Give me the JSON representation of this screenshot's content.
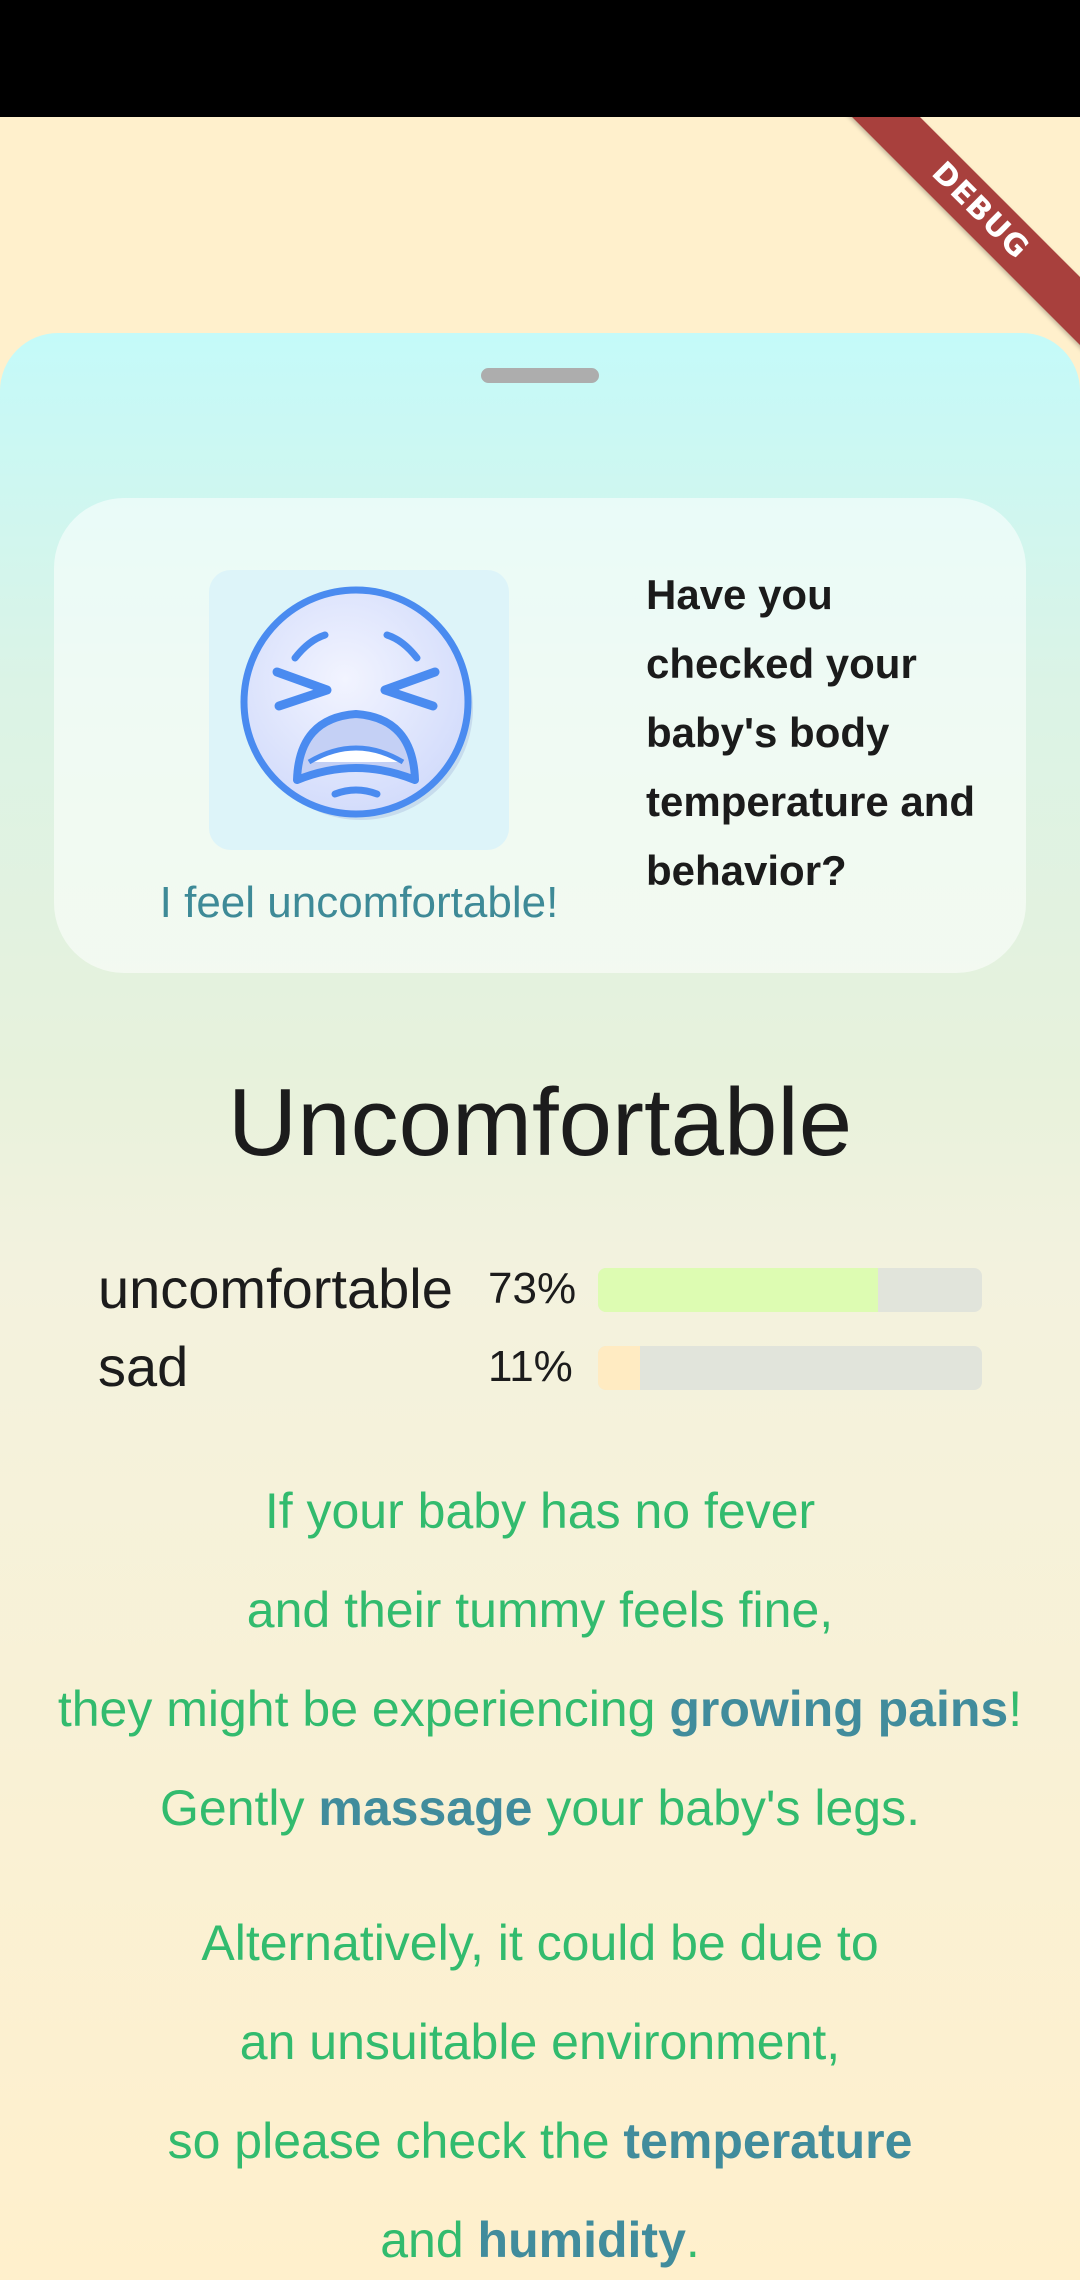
{
  "debug_banner": "DEBUG",
  "card": {
    "emoji": "tired-face-icon",
    "caption": "I feel uncomfortable!",
    "question": "Have you checked your baby's body temperature and behavior?"
  },
  "result_title": "Uncomfortable",
  "probabilities": [
    {
      "label": "uncomfortable",
      "percent_text": "73%",
      "percent": 73,
      "color": "#DDFCB2"
    },
    {
      "label": "sad",
      "percent_text": "11%",
      "percent": 11,
      "color": "#FFEBC2"
    }
  ],
  "advice": {
    "p1": {
      "line1": "If your baby has no fever",
      "line2": "and their tummy feels fine,",
      "line3_pre": "they might be experiencing ",
      "line3_hl": "growing pains",
      "line3_post": "!",
      "line4_pre": "Gently ",
      "line4_hl": "massage",
      "line4_post": " your baby's legs."
    },
    "p2": {
      "line1": "Alternatively, it could be due to",
      "line2": "an unsuitable environment,",
      "line3_pre": "so please check the ",
      "line3_hl": "temperature",
      "line4_pre": "and ",
      "line4_hl": "humidity",
      "line4_post": "."
    }
  },
  "colors": {
    "accent_green": "#32BB6E",
    "accent_teal": "#418C9C",
    "background": "#FFF0CC"
  }
}
